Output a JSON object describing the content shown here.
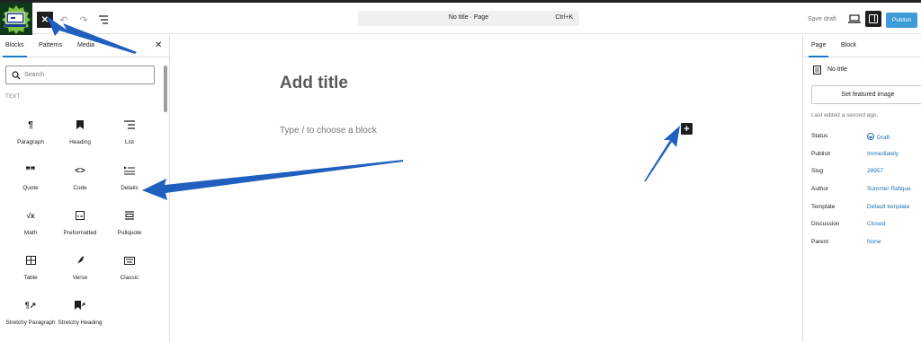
{
  "topbar": {
    "command_title": "No title · Page",
    "command_shortcut": "Ctrl+K",
    "save_draft": "Save draft",
    "publish": "Publish"
  },
  "inserter": {
    "tabs": [
      "Blocks",
      "Patterns",
      "Media"
    ],
    "search_placeholder": "Search",
    "section": "TEXT",
    "blocks": [
      {
        "label": "Paragraph",
        "icon": "¶"
      },
      {
        "label": "Heading",
        "icon": "bookmark"
      },
      {
        "label": "List",
        "icon": "list"
      },
      {
        "label": "Quote",
        "icon": "❞❞"
      },
      {
        "label": "Code",
        "icon": "<>"
      },
      {
        "label": "Details",
        "icon": "details"
      },
      {
        "label": "Math",
        "icon": "√x"
      },
      {
        "label": "Preformatted",
        "icon": "pre"
      },
      {
        "label": "Pullquote",
        "icon": "pullquote"
      },
      {
        "label": "Table",
        "icon": "table"
      },
      {
        "label": "Verse",
        "icon": "feather"
      },
      {
        "label": "Classic",
        "icon": "keyboard"
      },
      {
        "label": "Stretchy Paragraph",
        "icon": "¶↗"
      },
      {
        "label": "Stretchy Heading",
        "icon": "bookmark↗"
      }
    ]
  },
  "canvas": {
    "title_placeholder": "Add title",
    "block_placeholder": "Type / to choose a block"
  },
  "settings": {
    "tabs": [
      "Page",
      "Block"
    ],
    "doc_title": "No title",
    "featured_image": "Set featured image",
    "last_edited": "Last edited a second ago.",
    "properties": [
      {
        "label": "Status",
        "value": "Draft"
      },
      {
        "label": "Publish",
        "value": "Immediately"
      },
      {
        "label": "Slug",
        "value": "28957"
      },
      {
        "label": "Author",
        "value": "Summer Rafique"
      },
      {
        "label": "Template",
        "value": "Default template"
      },
      {
        "label": "Discussion",
        "value": "Closed"
      },
      {
        "label": "Parent",
        "value": "None"
      }
    ]
  },
  "colors": {
    "accent": "#1a7ac7",
    "publish": "#3d9bd8",
    "annotation_arrow": "#1f5fbf"
  }
}
